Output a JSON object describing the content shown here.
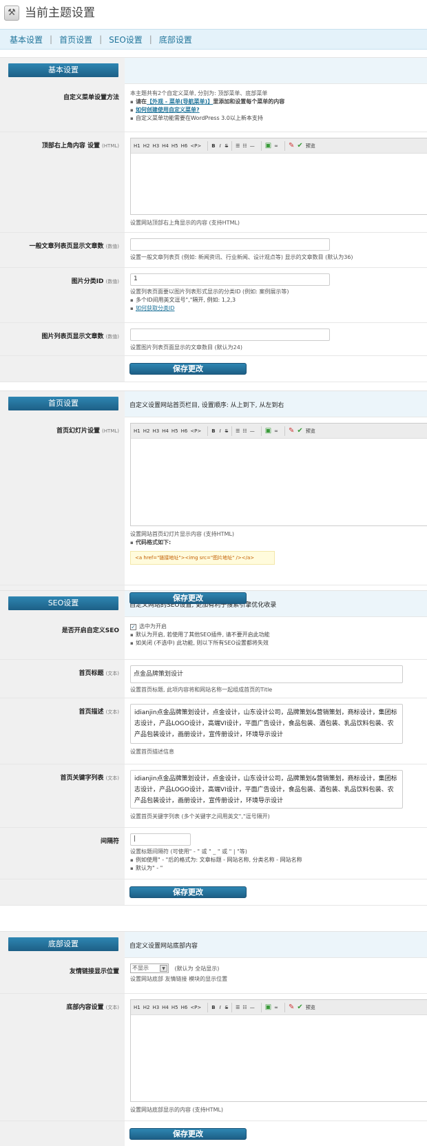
{
  "page": {
    "title": "当前主题设置"
  },
  "nav": {
    "tabs": [
      "基本设置",
      "首页设置",
      "SEO设置",
      "底部设置"
    ]
  },
  "editor_toolbar": {
    "headings": [
      "H1",
      "H2",
      "H3",
      "H4",
      "H5",
      "H6",
      "<P>"
    ],
    "bold": "B",
    "italic": "I",
    "strike": "S",
    "preview": "预览"
  },
  "save_label": "保存更改",
  "basic": {
    "tab": "基本设置",
    "menu": {
      "label": "自定义菜单设置方法",
      "intro": "本主题共有2个自定义菜单, 分别为: 顶部菜单、底部菜单",
      "b1_pre": "请在",
      "b1_link": "【外观 - 菜单(导航菜单)】",
      "b1_post": "里添加和设置每个菜单的内容",
      "b2_link": "如何创建使用自定义菜单?",
      "b3": "自定义菜单功能需要在WordPress 3.0以上新本支持"
    },
    "top_right": {
      "label": "顶部右上角内容 设置",
      "type": "(HTML)",
      "hint": "设置网站顶部右上角显示的内容 (支持HTML)"
    },
    "article_count": {
      "label": "一般文章列表页显示文章数",
      "type": "(数值)",
      "value": "",
      "hint": "设置一般文章列表页 (例如: 新闻资讯、行业新闻、设计观点等) 显示的文章数目 (默认为36)"
    },
    "image_cat": {
      "label": "图片分类ID",
      "type": "(数值)",
      "value": "1",
      "hint": "设置列表页面要以图片列表形式显示的分类ID (例如: 案例展示等)",
      "b1": "多个ID间用英文逗号\",\"隔开, 例如: 1,2,3",
      "b2_link": "如何获取分类ID"
    },
    "image_count": {
      "label": "图片列表页显示文章数",
      "type": "(数值)",
      "value": "",
      "hint": "设置图片列表页面显示的文章数目 (默认为24)"
    }
  },
  "home": {
    "tab": "首页设置",
    "desc": "自定义设置网站首页栏目, 设置顺序: 从上到下, 从左到右",
    "slider": {
      "label": "首页幻灯片设置",
      "type": "(HTML)",
      "hint": "设置网站首页幻灯片显示内容 (支持HTML)",
      "code_title": "代码格式如下:",
      "code": "<a href=\"链接地址\"><img src=\"图片地址\" /></a>"
    }
  },
  "seo": {
    "tab": "SEO设置",
    "desc": "自定义网站的SEO设置, 更加有利于搜索引擎优化收录",
    "enable": {
      "label": "是否开启自定义SEO",
      "checkbox": "选中为开启",
      "b1": "默认为开启, 若使用了其他SEO插件, 请不要开启此功能",
      "b2": "如关闭 (不选中) 此功能, 则以下所有SEO设置都将失效"
    },
    "home_title": {
      "label": "首页标题",
      "type": "(文本)",
      "value": "点金品牌策划设计",
      "hint": "设置首页标题, 此项内容将和网站名称一起组成首页的Title"
    },
    "home_desc": {
      "label": "首页描述",
      "type": "(文本)",
      "value": "idianjin点金品牌策划设计，点金设计，山东设计公司，品牌策划&营销策划，商标设计，集团标志设计，产品LOGO设计，高端VI设计，平面广告设计，食品包装、酒包装、乳品饮料包装、农产品包装设计，画册设计，宣传册设计，环境导示设计",
      "hint": "设置首页描述信息"
    },
    "home_keywords": {
      "label": "首页关键字列表",
      "type": "(文本)",
      "value": "idianjin点金品牌策划设计，点金设计，山东设计公司，品牌策划&营销策划，商标设计，集团标志设计，产品LOGO设计，高端VI设计，平面广告设计，食品包装、酒包装、乳品饮料包装、农产品包装设计，画册设计，宣传册设计，环境导示设计",
      "hint": "设置首页关键字列表 (多个关键字之间用英文\",\"逗号隔开)"
    },
    "separator": {
      "label": "间隔符",
      "value": "|",
      "hint": "设置标题间隔符 (可使用\" - \" 或 \" _ \" 或 \" | \"等)",
      "b1": "例如使用\" - \"后的格式为: 文章标题 - 网站名称, 分类名称 - 网站名称",
      "b2": "默认为\" - \""
    }
  },
  "footer": {
    "tab": "底部设置",
    "desc": "自定义设置网站底部内容",
    "links": {
      "label": "友情链接显示位置",
      "selected": "不显示",
      "default_note": "(默认为 全站显示)",
      "hint": "设置网站底部 友情链接 模块的显示位置"
    },
    "content": {
      "label": "底部内容设置",
      "type": "(文本)",
      "hint": "设置网站底部显示的内容 (支持HTML)"
    }
  }
}
